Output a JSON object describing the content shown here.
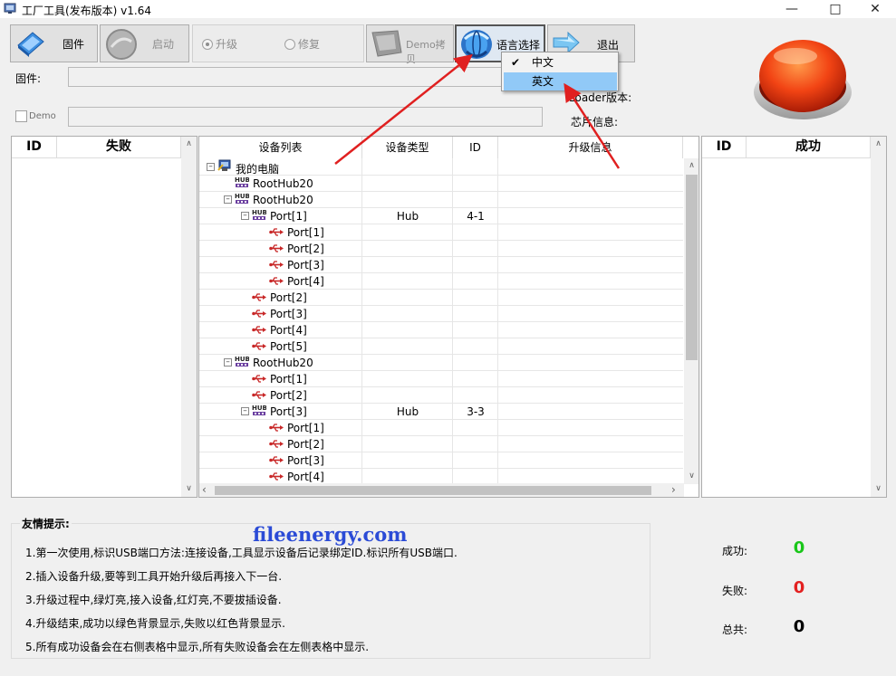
{
  "window": {
    "title": "工厂工具(发布版本) v1.64"
  },
  "toolbar": {
    "firmware_label": "固件",
    "start_label": "启动",
    "upgrade_label": "升级",
    "repair_label": "修复",
    "demo_copy_label": "Demo拷贝",
    "language_label": "语言选择",
    "exit_label": "退出"
  },
  "form": {
    "firmware_label": "固件:",
    "demo_label": "Demo",
    "loader_label": "Loader版本:",
    "chip_label": "芯片信息:"
  },
  "language_menu": {
    "items": [
      {
        "label": "中文",
        "checked": true
      },
      {
        "label": "英文",
        "checked": false
      }
    ]
  },
  "fail_table": {
    "id_header": "ID",
    "title_header": "失败"
  },
  "success_table": {
    "id_header": "ID",
    "title_header": "成功"
  },
  "device_tree": {
    "headers": {
      "list": "设备列表",
      "type": "设备类型",
      "id": "ID",
      "info": "升级信息"
    },
    "rows": [
      {
        "label": "我的电脑",
        "level": 0,
        "icon": "computer",
        "expand": "-",
        "type": "",
        "id": ""
      },
      {
        "label": "RootHub20",
        "level": 1,
        "icon": "hub",
        "expand": "",
        "type": "",
        "id": ""
      },
      {
        "label": "RootHub20",
        "level": 1,
        "icon": "hub",
        "expand": "-",
        "type": "",
        "id": ""
      },
      {
        "label": "Port[1]",
        "level": 2,
        "icon": "hub",
        "expand": "-",
        "type": "Hub",
        "id": "4-1"
      },
      {
        "label": "Port[1]",
        "level": 3,
        "icon": "usb",
        "expand": "",
        "type": "",
        "id": ""
      },
      {
        "label": "Port[2]",
        "level": 3,
        "icon": "usb",
        "expand": "",
        "type": "",
        "id": ""
      },
      {
        "label": "Port[3]",
        "level": 3,
        "icon": "usb",
        "expand": "",
        "type": "",
        "id": ""
      },
      {
        "label": "Port[4]",
        "level": 3,
        "icon": "usb",
        "expand": "",
        "type": "",
        "id": ""
      },
      {
        "label": "Port[2]",
        "level": 2,
        "icon": "usb",
        "expand": "",
        "type": "",
        "id": ""
      },
      {
        "label": "Port[3]",
        "level": 2,
        "icon": "usb",
        "expand": "",
        "type": "",
        "id": ""
      },
      {
        "label": "Port[4]",
        "level": 2,
        "icon": "usb",
        "expand": "",
        "type": "",
        "id": ""
      },
      {
        "label": "Port[5]",
        "level": 2,
        "icon": "usb",
        "expand": "",
        "type": "",
        "id": ""
      },
      {
        "label": "RootHub20",
        "level": 1,
        "icon": "hub",
        "expand": "-",
        "type": "",
        "id": ""
      },
      {
        "label": "Port[1]",
        "level": 2,
        "icon": "usb",
        "expand": "",
        "type": "",
        "id": ""
      },
      {
        "label": "Port[2]",
        "level": 2,
        "icon": "usb",
        "expand": "",
        "type": "",
        "id": ""
      },
      {
        "label": "Port[3]",
        "level": 2,
        "icon": "hub",
        "expand": "-",
        "type": "Hub",
        "id": "3-3"
      },
      {
        "label": "Port[1]",
        "level": 3,
        "icon": "usb",
        "expand": "",
        "type": "",
        "id": ""
      },
      {
        "label": "Port[2]",
        "level": 3,
        "icon": "usb",
        "expand": "",
        "type": "",
        "id": ""
      },
      {
        "label": "Port[3]",
        "level": 3,
        "icon": "usb",
        "expand": "",
        "type": "",
        "id": ""
      },
      {
        "label": "Port[4]",
        "level": 3,
        "icon": "usb",
        "expand": "",
        "type": "",
        "id": ""
      }
    ]
  },
  "hints": {
    "title": "友情提示:",
    "lines": [
      "1.第一次使用,标识USB端口方法:连接设备,工具显示设备后记录绑定ID.标识所有USB端口.",
      "2.插入设备升级,要等到工具开始升级后再接入下一台.",
      "3.升级过程中,绿灯亮,接入设备,红灯亮,不要拔插设备.",
      "4.升级结束,成功以绿色背景显示,失败以红色背景显示.",
      "5.所有成功设备会在右侧表格中显示,所有失败设备会在左侧表格中显示."
    ]
  },
  "watermark": "fileenergy.com",
  "stats": {
    "success_label": "成功:",
    "success_value": "0",
    "fail_label": "失败:",
    "fail_value": "0",
    "total_label": "总共:",
    "total_value": "0"
  },
  "colors": {
    "success": "#19c619",
    "fail": "#e32020",
    "menu_highlight": "#91c9f7",
    "annotation_arrow": "#e02020"
  },
  "icons": {
    "minimize": "minimize-icon",
    "maximize": "maximize-icon",
    "close": "close-icon"
  }
}
